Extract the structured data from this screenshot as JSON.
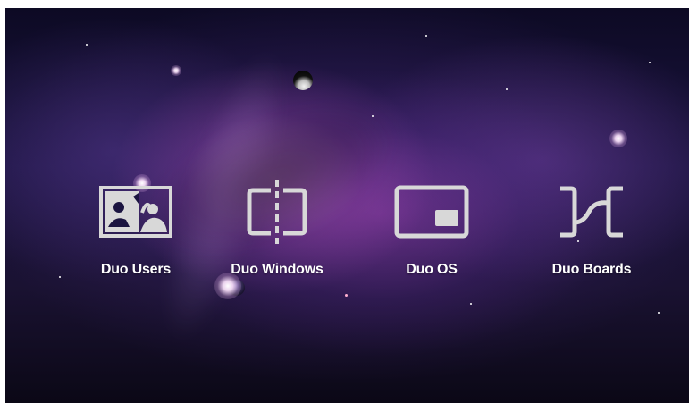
{
  "menu": {
    "items": [
      {
        "label": "Duo Users",
        "icon": "users-icon"
      },
      {
        "label": "Duo Windows",
        "icon": "split-windows-icon"
      },
      {
        "label": "Duo OS",
        "icon": "picture-in-picture-icon"
      },
      {
        "label": "Duo Boards",
        "icon": "boards-connector-icon"
      }
    ]
  },
  "colors": {
    "icon": "#d8d8d8",
    "label": "#ffffff",
    "background": "#1b1440"
  }
}
